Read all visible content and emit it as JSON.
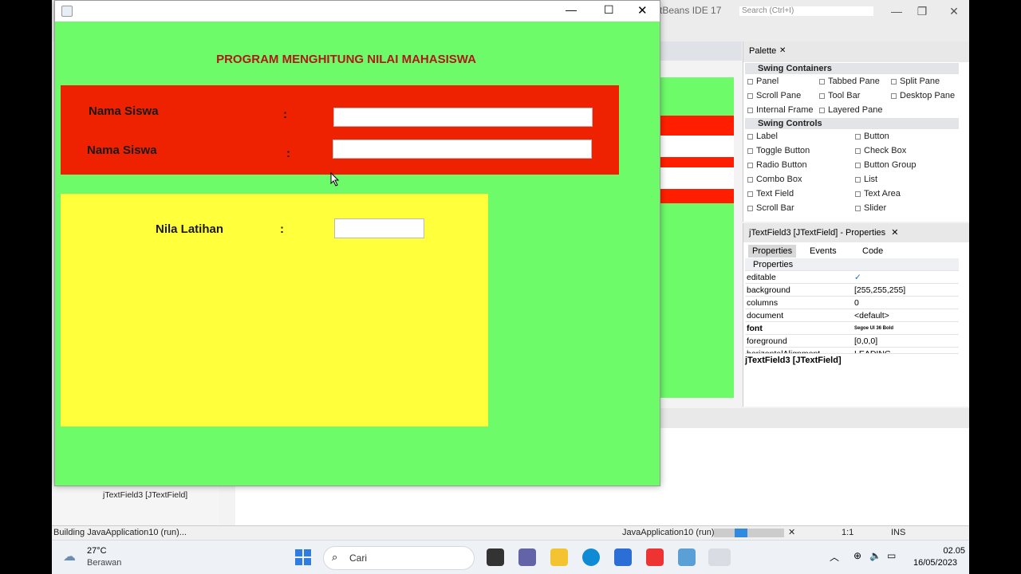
{
  "ide": {
    "title": "tBeans IDE 17",
    "search_placeholder": "Search (Ctrl+I)",
    "minimize": "—",
    "maximize": "❐",
    "close": "✕"
  },
  "palette": {
    "tab": "Palette",
    "close": "✕",
    "categories": [
      {
        "name": "Swing Containers",
        "items": [
          "Panel",
          "Tabbed Pane",
          "Split Pane",
          "Scroll Pane",
          "Tool Bar",
          "Desktop Pane",
          "Internal Frame",
          "Layered Pane"
        ]
      },
      {
        "name": "Swing Controls",
        "items": [
          "Label",
          "Button",
          "Toggle Button",
          "Check Box",
          "Radio Button",
          "Button Group",
          "Combo Box",
          "List",
          "Text Field",
          "Text Area",
          "Scroll Bar",
          "Slider"
        ]
      }
    ]
  },
  "properties": {
    "title": "jTextField3 [JTextField] - Properties",
    "close": "✕",
    "tabs": [
      "Properties",
      "Events",
      "Code"
    ],
    "section": "Properties",
    "rows": [
      {
        "key": "editable",
        "value": "✓"
      },
      {
        "key": "background",
        "value": "[255,255,255]"
      },
      {
        "key": "columns",
        "value": "0"
      },
      {
        "key": "document",
        "value": "<default>"
      },
      {
        "key": "font",
        "value": "Segoe UI 36 Bold"
      },
      {
        "key": "foreground",
        "value": "[0,0,0]"
      },
      {
        "key": "horizontalAlignment",
        "value": "LEADING"
      }
    ],
    "footer": "jTextField3 [JTextField]"
  },
  "navigator": {
    "item": "jTextField3 [JTextField]"
  },
  "status": {
    "left": "Building JavaApplication10 (run)...",
    "task": "JavaApplication10 (run)",
    "position": "1:1",
    "mode": "INS",
    "progress": 0.18
  },
  "taskbar": {
    "temperature": "27°C",
    "weather": "Berawan",
    "search": "Cari",
    "time": "02.05",
    "date": "16/05/2023"
  },
  "app": {
    "heading": "PROGRAM MENGHITUNG NILAI MAHASISWA",
    "fields": [
      {
        "label": "Nama Siswa",
        "colon": ":",
        "value": ""
      },
      {
        "label": "Nama Siswa",
        "colon": ":",
        "value": ""
      }
    ],
    "score": {
      "label": "Nila Latihan",
      "colon": ":",
      "value": ""
    },
    "window_min": "—",
    "window_max": "☐",
    "window_close": "✕"
  },
  "colors": {
    "app_bg": "#6dfb6a",
    "red_panel": "#ee2200",
    "yellow_panel": "#ffff3c",
    "heading": "#b01818"
  }
}
